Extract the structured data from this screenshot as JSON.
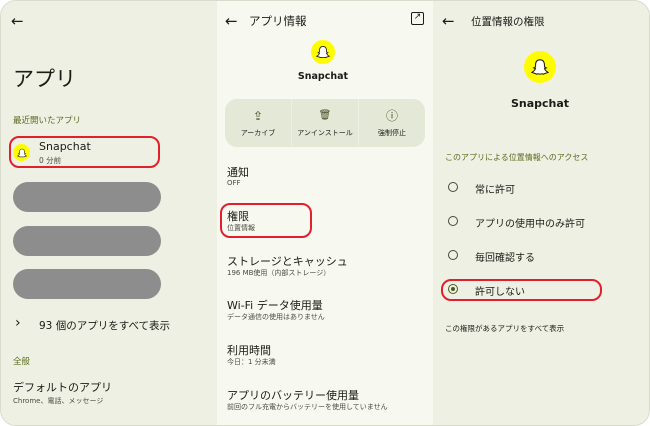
{
  "left_panel": {
    "back_glyph": "←",
    "title": "アプリ",
    "recent_caption": "最近開いたアプリ",
    "recent_app": {
      "name": "Snapchat",
      "time": "0 分前"
    },
    "see_all": {
      "chevron": "›",
      "label": "93 個のアプリをすべて表示"
    },
    "general_caption": "全般",
    "default_apps": {
      "title": "デフォルトのアプリ",
      "sub": "Chrome、電話、メッセージ"
    }
  },
  "middle_panel": {
    "back_glyph": "←",
    "title": "アプリ情報",
    "open_glyph": "↗",
    "app_name": "Snapchat",
    "actions": [
      {
        "icon": "archive-icon",
        "glyph": "⇪",
        "label": "アーカイブ"
      },
      {
        "icon": "trash-icon",
        "glyph": "🗑",
        "label": "アンインストール"
      },
      {
        "icon": "stop-icon",
        "glyph": "ⓘ",
        "label": "強制停止"
      }
    ],
    "items": [
      {
        "title": "通知",
        "sub": "OFF"
      },
      {
        "title": "権限",
        "sub": "位置情報"
      },
      {
        "title": "ストレージとキャッシュ",
        "sub": "196 MB使用（内部ストレージ）"
      },
      {
        "title": "Wi-Fi データ使用量",
        "sub": "データ通信の使用はありません"
      },
      {
        "title": "利用時間",
        "sub": "今日：1 分未満"
      },
      {
        "title": "アプリのバッテリー使用量",
        "sub": "前回のフル充電からバッテリーを使用していません"
      }
    ]
  },
  "right_panel": {
    "back_glyph": "←",
    "title": "位置情報の権限",
    "app_name": "Snapchat",
    "section_caption": "このアプリによる位置情報へのアクセス",
    "options": [
      {
        "label": "常に許可",
        "selected": false
      },
      {
        "label": "アプリの使用中のみ許可",
        "selected": false
      },
      {
        "label": "毎回確認する",
        "selected": false
      },
      {
        "label": "許可しない",
        "selected": true
      }
    ],
    "footer_link": "この権限があるアプリをすべて表示"
  },
  "colors": {
    "highlight": "#e0202d",
    "snapchat_yellow": "#fffc00",
    "accent": "#4b5b20"
  }
}
